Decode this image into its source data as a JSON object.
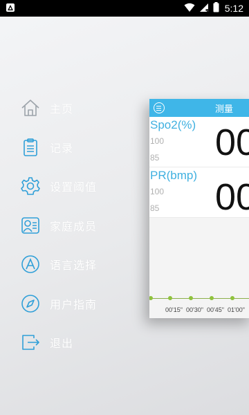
{
  "status_bar": {
    "time": "5:12",
    "icons": [
      "app-notification-icon",
      "wifi-icon",
      "signal-icon",
      "battery-icon"
    ]
  },
  "menu": {
    "items": [
      {
        "label": "主页",
        "icon": "home-icon"
      },
      {
        "label": "记录",
        "icon": "clipboard-icon"
      },
      {
        "label": "设置阈值",
        "icon": "gear-icon"
      },
      {
        "label": "家庭成员",
        "icon": "family-members-icon"
      },
      {
        "label": "语言选择",
        "icon": "language-a-icon"
      },
      {
        "label": "用户指南",
        "icon": "compass-icon"
      },
      {
        "label": "退出",
        "icon": "exit-icon"
      }
    ]
  },
  "card": {
    "title": "测量",
    "spo2": {
      "label": "Spo2(%)",
      "high": "100",
      "low": "85",
      "value": "00"
    },
    "pr": {
      "label": "PR(bmp)",
      "high": "100",
      "low": "85",
      "value": "00"
    },
    "time_ticks": [
      "00'15\"",
      "00'30\"",
      "00'45\"",
      "01'00\""
    ]
  },
  "colors": {
    "accent": "#3fb6e8",
    "menu_icon": "#2f9fd8",
    "menu_text": "#ffffff",
    "axis_dot": "#8fc23d"
  }
}
